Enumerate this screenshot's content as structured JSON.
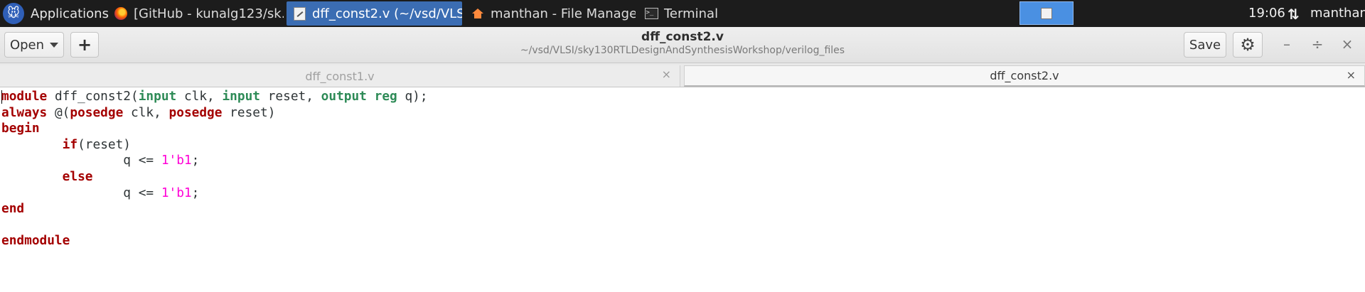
{
  "panel": {
    "applications_label": "Applications",
    "tasks": [
      {
        "label": "[GitHub - kunalg123/sk...",
        "icon": "firefox-icon",
        "active": false
      },
      {
        "label": "dff_const2.v (~/vsd/VLS...",
        "icon": "text-editor-icon",
        "active": true
      },
      {
        "label": "manthan - File Manager",
        "icon": "home-folder-icon",
        "active": false
      },
      {
        "label": "Terminal",
        "icon": "terminal-icon",
        "active": false
      }
    ],
    "clock": "19:06",
    "user": "manthan"
  },
  "header": {
    "open_label": "Open",
    "new_tab_label": "+",
    "title": "dff_const2.v",
    "subtitle": "~/vsd/VLSI/sky130RTLDesignAndSynthesisWorkshop/verilog_files",
    "save_label": "Save",
    "minimize_label": "–",
    "maximize_label": "÷",
    "close_label": "×"
  },
  "tabs": [
    {
      "label": "dff_const1.v",
      "active": false,
      "close": "×"
    },
    {
      "label": "dff_const2.v",
      "active": true,
      "close": "×"
    }
  ],
  "code_lines": [
    [
      {
        "t": "module",
        "c": "kw"
      },
      {
        "t": " dff_const2("
      },
      {
        "t": "input",
        "c": "ty"
      },
      {
        "t": " clk, "
      },
      {
        "t": "input",
        "c": "ty"
      },
      {
        "t": " reset, "
      },
      {
        "t": "output",
        "c": "ty"
      },
      {
        "t": " "
      },
      {
        "t": "reg",
        "c": "ty"
      },
      {
        "t": " q);"
      }
    ],
    [
      {
        "t": "always",
        "c": "kw"
      },
      {
        "t": " @("
      },
      {
        "t": "posedge",
        "c": "kw"
      },
      {
        "t": " clk, "
      },
      {
        "t": "posedge",
        "c": "kw"
      },
      {
        "t": " reset)"
      }
    ],
    [
      {
        "t": "begin",
        "c": "kw"
      }
    ],
    [
      {
        "t": "        "
      },
      {
        "t": "if",
        "c": "kw"
      },
      {
        "t": "(reset)"
      }
    ],
    [
      {
        "t": "                q <= "
      },
      {
        "t": "1'b1",
        "c": "num"
      },
      {
        "t": ";"
      }
    ],
    [
      {
        "t": "        "
      },
      {
        "t": "else",
        "c": "kw"
      }
    ],
    [
      {
        "t": "                q <= "
      },
      {
        "t": "1'b1",
        "c": "num"
      },
      {
        "t": ";"
      }
    ],
    [
      {
        "t": "end",
        "c": "kw"
      }
    ],
    [
      {
        "t": ""
      }
    ],
    [
      {
        "t": "endmodule",
        "c": "kw"
      }
    ]
  ],
  "colors": {
    "keyword": "#a40000",
    "type": "#2e8b57",
    "number": "#ff00d6",
    "active_task": "#3b6db3",
    "panel_bg": "#1c1c1c"
  }
}
